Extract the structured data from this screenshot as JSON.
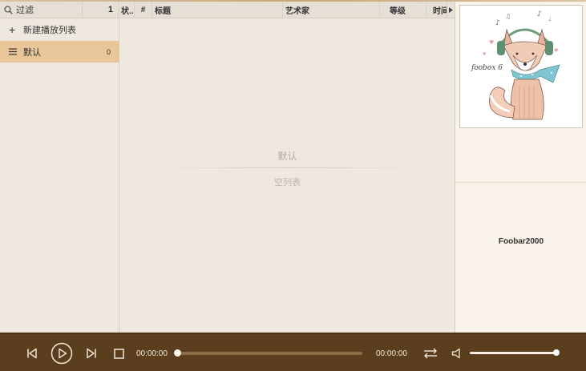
{
  "colors": {
    "accent": "#e8c69a",
    "player_bar": "#5b3e1d",
    "panel_bg": "#efe8df",
    "right_bg": "#f9f2e8"
  },
  "sidebar": {
    "filter_label": "过滤",
    "filter_count": "1",
    "new_playlist_label": "新建播放列表",
    "playlists": [
      {
        "name": "默认",
        "count": "0",
        "selected": true
      }
    ]
  },
  "playlist_view": {
    "columns": [
      {
        "key": "status",
        "label": "状..."
      },
      {
        "key": "number",
        "label": "#"
      },
      {
        "key": "title",
        "label": "标题"
      },
      {
        "key": "artist",
        "label": "艺术家"
      },
      {
        "key": "rating",
        "label": "等级"
      },
      {
        "key": "time",
        "label": "时间"
      }
    ],
    "empty_title": "默认",
    "empty_subtitle": "空列表"
  },
  "right_panel": {
    "cover_text": "foobox 6",
    "app_name": "Foobar2000"
  },
  "player": {
    "elapsed": "00:00:00",
    "total": "00:00:00",
    "seek_fraction": 0,
    "volume_fraction": 1,
    "icons": [
      "previous-icon",
      "play-icon",
      "next-icon",
      "stop-icon",
      "repeat-icon",
      "volume-icon"
    ]
  }
}
